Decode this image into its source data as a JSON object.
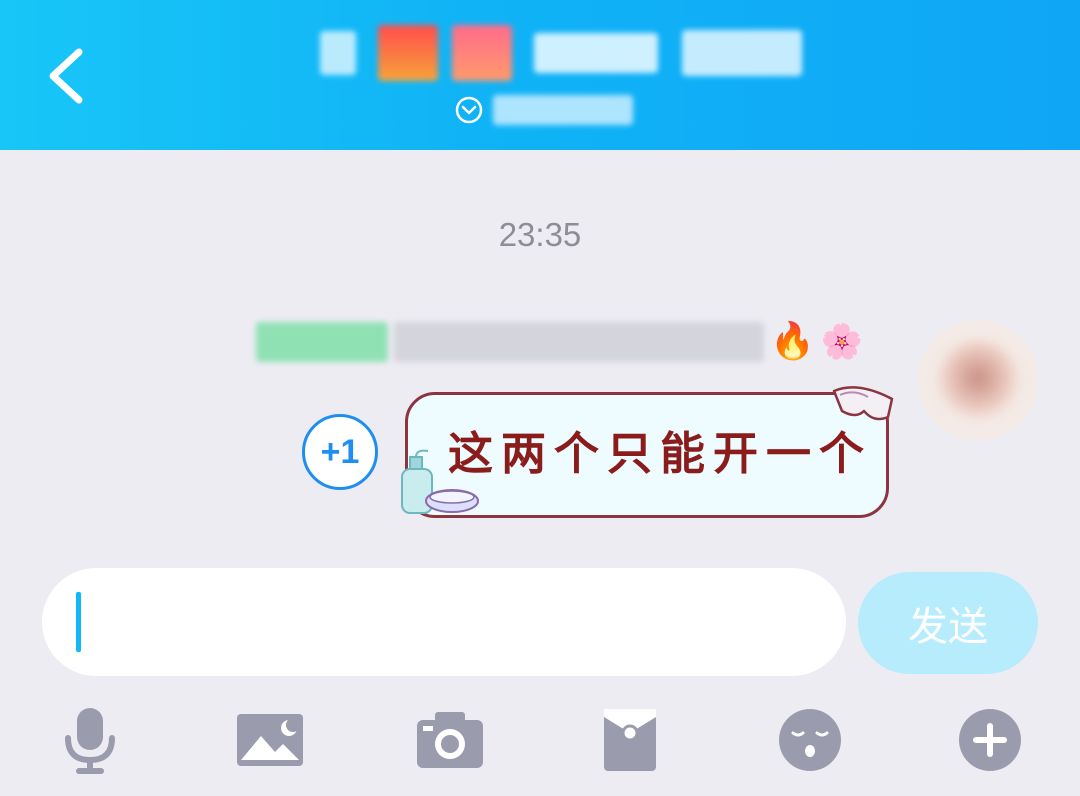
{
  "header": {
    "back_icon": "chevron-left-icon",
    "title_redacted": "pixelated group name",
    "subtitle_icon": "chevron-down-circle-icon"
  },
  "chat": {
    "timestamp": "23:35",
    "sender_emojis": [
      "🔥",
      "🌸"
    ],
    "message": {
      "text": "这两个只能开一个",
      "text_color": "#8a1c1c",
      "border_color": "#8b3540",
      "plus_one_label": "+1"
    }
  },
  "composer": {
    "placeholder": "",
    "send_label": "发送"
  },
  "toolbar": {
    "items": [
      {
        "name": "voice",
        "icon": "microphone-icon"
      },
      {
        "name": "image",
        "icon": "image-icon"
      },
      {
        "name": "camera",
        "icon": "camera-icon"
      },
      {
        "name": "red-packet",
        "icon": "red-packet-icon"
      },
      {
        "name": "emoji",
        "icon": "emoji-face-icon"
      },
      {
        "name": "more",
        "icon": "plus-circle-icon"
      }
    ]
  },
  "colors": {
    "header_start": "#18c6f7",
    "header_end": "#0fa6f6",
    "accent": "#1e8ff1",
    "icon_gray": "#9b9bae",
    "send_disabled": "#b7ecfd"
  }
}
